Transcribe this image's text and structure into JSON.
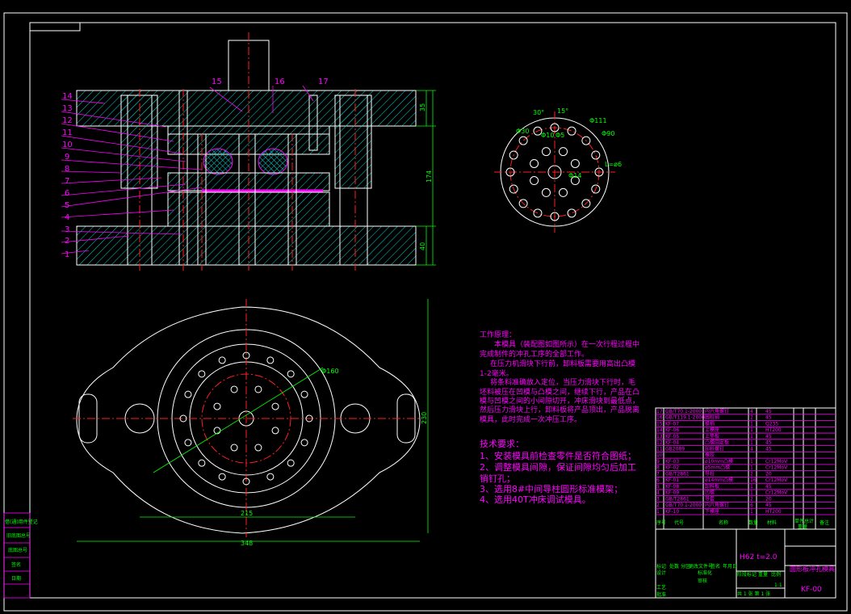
{
  "section_view": {
    "part_labels": [
      "1",
      "2",
      "3",
      "4",
      "5",
      "6",
      "7",
      "8",
      "9",
      "10",
      "11",
      "12",
      "13",
      "14",
      "15",
      "16",
      "17"
    ],
    "dimensions": [
      "35",
      "174",
      "40"
    ]
  },
  "hole_detail": {
    "dimensions": [
      "30°",
      "15°",
      "Φ111",
      "Φ30",
      "Φ10",
      "Φ5",
      "Φ90",
      "Φ14",
      "L=ø6"
    ]
  },
  "plan_view": {
    "dimensions": [
      "Φ160",
      "230",
      "215",
      "348"
    ]
  },
  "notes": {
    "work_title": "工作原理：",
    "work_lines": [
      "本模具（装配图如图所示）在一次行程过程中",
      "完成制件的冲孔工序的全部工作。",
      "在压力机滑块下行前，卸料板需要用高出凸模",
      "1-2毫米。",
      "将条料准确放入定位，当压力滑块下行时，毛",
      "坯料被压在凹模与凸模之间，继续下行，产品在凸",
      "模与凹模之间的小间隙切开，冲床滑块到最低点，",
      "然后压力滑块上行，卸料板将产品顶出，产品脱离",
      "模具，此时完成一次冲压工序。"
    ],
    "tech_title": "技术要求：",
    "tech_lines": [
      "1、安装模具前检查零件是否符合图纸；",
      "2、调整模具间隙，保证间隙均匀后加工",
      "销钉孔；",
      "3、选用8#中间导柱圆形标准模架；",
      "4、选用40T冲床调试模具。"
    ]
  },
  "bom": {
    "rows": [
      [
        "17",
        "GB/T70.1-2000",
        "内六角螺钉",
        "4",
        "45"
      ],
      [
        "16",
        "GB/T119.1-2000",
        "圆柱销",
        "2",
        "45"
      ],
      [
        "15",
        "KF-07",
        "模柄",
        "1",
        "Q235"
      ],
      [
        "14",
        "KF-06",
        "上模座",
        "1",
        "HT200"
      ],
      [
        "13",
        "KF-05",
        "上垫板",
        "1",
        "45"
      ],
      [
        "12",
        "KF-04",
        "凸模固定板",
        "1",
        "45"
      ],
      [
        "11",
        "GB2089",
        "卸料螺钉",
        "4",
        "45"
      ],
      [
        "10",
        "",
        "橡胶",
        "",
        ""
      ],
      [
        "9",
        "KF-03",
        "ø10mm凸模",
        "1",
        "Cr12MoV"
      ],
      [
        "8",
        "KF-02",
        "ø5mm凸模",
        "1",
        "Cr12MoV"
      ],
      [
        "7",
        "GB/T2861",
        "导柱",
        "2",
        "20"
      ],
      [
        "6",
        "KF-01",
        "ø14mm凸模",
        "16",
        "Cr12MoV"
      ],
      [
        "5",
        "KF-08",
        "卸料板",
        "1",
        "45"
      ],
      [
        "4",
        "KF-09",
        "凹模",
        "1",
        "Cr12MoV"
      ],
      [
        "3",
        "GB/T2861",
        "导套",
        "2",
        "20"
      ],
      [
        "2",
        "GB/T70.1-2000",
        "内六角螺钉",
        "6",
        "45"
      ],
      [
        "1",
        "KF-10",
        "下模座",
        "1",
        "HT200"
      ]
    ],
    "headers": [
      "序号",
      "代号",
      "名称",
      "数量",
      "材料",
      "单件",
      "总计",
      "备注"
    ],
    "weight_label": "重量"
  },
  "title_block": {
    "material": "H62  t=2.0",
    "drawing_title": "圆形板冲孔模具",
    "drawing_number": "KF-00",
    "revision_headers": [
      "标记",
      "处数",
      "分区",
      "更改文件号",
      "签名",
      "年月日"
    ],
    "sign_labels": [
      "设计",
      "标准化",
      "审核",
      "工艺",
      "批准"
    ],
    "stage_headers": [
      "阶段标记",
      "重量",
      "比例"
    ],
    "scale": "1:1",
    "sheet": "共 1 张  第 1 张"
  },
  "side_table": {
    "labels": [
      "借(通)用件登记",
      "旧底图总号",
      "底图总号",
      "签名",
      "日期"
    ]
  }
}
